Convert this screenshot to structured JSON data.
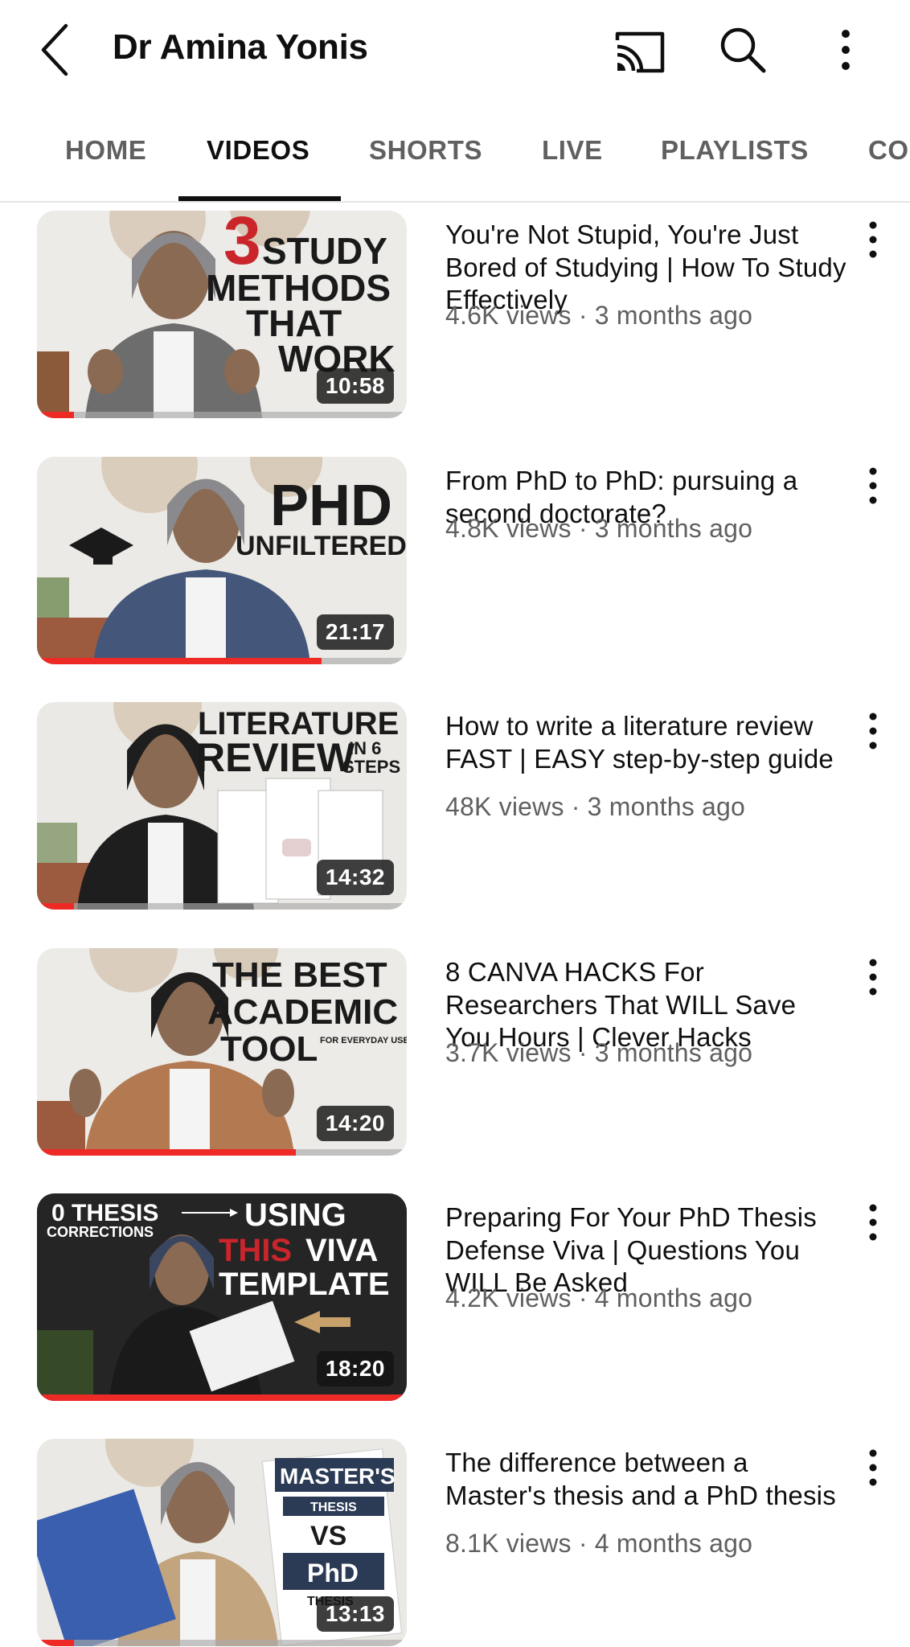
{
  "header": {
    "channel_name": "Dr Amina Yonis",
    "icons": [
      "back-arrow-icon",
      "cast-icon",
      "search-icon",
      "more-vertical-icon"
    ]
  },
  "tabs": [
    {
      "label": "HOME",
      "active": false
    },
    {
      "label": "VIDEOS",
      "active": true
    },
    {
      "label": "SHORTS",
      "active": false
    },
    {
      "label": "LIVE",
      "active": false
    },
    {
      "label": "PLAYLISTS",
      "active": false
    },
    {
      "label": "CO",
      "active": false
    }
  ],
  "colors": {
    "text_primary": "#0f0f0f",
    "text_secondary": "#606060",
    "progress_red": "#ee2a26",
    "thumbnail_accent_red": "#c9252b",
    "thumbnail_navy": "#2b3a55"
  },
  "videos": [
    {
      "title": "You're Not Stupid, You're Just Bored of Studying | How To Study Effectively",
      "meta": "4.6K views · 3 months ago",
      "duration": "10:58",
      "watched_fraction": 0.1,
      "thumbnail_text": [
        "3",
        "STUDY",
        "METHODS",
        "THAT",
        "WORK"
      ]
    },
    {
      "title": "From PhD to PhD: pursuing a second doctorate?",
      "meta": "4.8K views · 3 months ago",
      "duration": "21:17",
      "watched_fraction": 0.77,
      "thumbnail_text": [
        "PHD",
        "UNFILTERED"
      ]
    },
    {
      "title": "How to write a literature review FAST | EASY step-by-step guide",
      "meta": "48K views · 3 months ago",
      "duration": "14:32",
      "watched_fraction": 0.1,
      "thumbnail_text": [
        "LITERATURE",
        "REVIEW",
        "IN 6",
        "STEPS"
      ]
    },
    {
      "title": "8 CANVA HACKS For Researchers That WILL Save You Hours | Clever Hacks",
      "meta": "3.7K views · 3 months ago",
      "duration": "14:20",
      "watched_fraction": 0.7,
      "thumbnail_text": [
        "THE BEST",
        "ACADEMIC",
        "TOOL",
        "FOR EVERYDAY USE"
      ]
    },
    {
      "title": "Preparing For Your PhD Thesis Defense Viva | Questions You WILL Be Asked",
      "meta": "4.2K views · 4 months ago",
      "duration": "18:20",
      "watched_fraction": 1.0,
      "thumbnail_text": [
        "0 THESIS",
        "CORRECTIONS",
        "USING",
        "THIS",
        "VIVA",
        "TEMPLATE"
      ]
    },
    {
      "title": "The difference between a Master's thesis and a PhD thesis",
      "meta": "8.1K views · 4 months ago",
      "duration": "13:13",
      "watched_fraction": 0.1,
      "thumbnail_text": [
        "MASTER'S",
        "THESIS",
        "VS",
        "PhD",
        "THESIS"
      ]
    }
  ]
}
